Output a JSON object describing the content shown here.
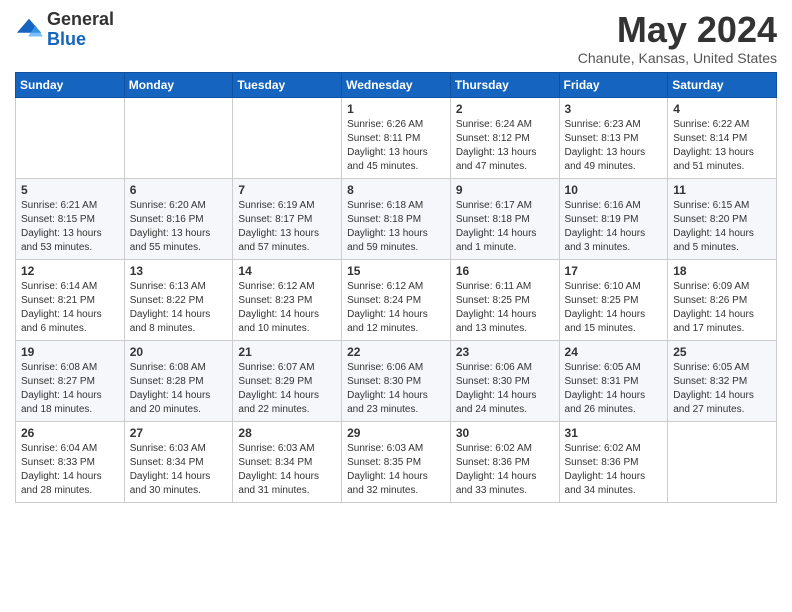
{
  "logo": {
    "general": "General",
    "blue": "Blue"
  },
  "header": {
    "title": "May 2024",
    "subtitle": "Chanute, Kansas, United States"
  },
  "weekdays": [
    "Sunday",
    "Monday",
    "Tuesday",
    "Wednesday",
    "Thursday",
    "Friday",
    "Saturday"
  ],
  "weeks": [
    [
      {
        "day": "",
        "sunrise": "",
        "sunset": "",
        "daylight": ""
      },
      {
        "day": "",
        "sunrise": "",
        "sunset": "",
        "daylight": ""
      },
      {
        "day": "",
        "sunrise": "",
        "sunset": "",
        "daylight": ""
      },
      {
        "day": "1",
        "sunrise": "Sunrise: 6:26 AM",
        "sunset": "Sunset: 8:11 PM",
        "daylight": "Daylight: 13 hours and 45 minutes."
      },
      {
        "day": "2",
        "sunrise": "Sunrise: 6:24 AM",
        "sunset": "Sunset: 8:12 PM",
        "daylight": "Daylight: 13 hours and 47 minutes."
      },
      {
        "day": "3",
        "sunrise": "Sunrise: 6:23 AM",
        "sunset": "Sunset: 8:13 PM",
        "daylight": "Daylight: 13 hours and 49 minutes."
      },
      {
        "day": "4",
        "sunrise": "Sunrise: 6:22 AM",
        "sunset": "Sunset: 8:14 PM",
        "daylight": "Daylight: 13 hours and 51 minutes."
      }
    ],
    [
      {
        "day": "5",
        "sunrise": "Sunrise: 6:21 AM",
        "sunset": "Sunset: 8:15 PM",
        "daylight": "Daylight: 13 hours and 53 minutes."
      },
      {
        "day": "6",
        "sunrise": "Sunrise: 6:20 AM",
        "sunset": "Sunset: 8:16 PM",
        "daylight": "Daylight: 13 hours and 55 minutes."
      },
      {
        "day": "7",
        "sunrise": "Sunrise: 6:19 AM",
        "sunset": "Sunset: 8:17 PM",
        "daylight": "Daylight: 13 hours and 57 minutes."
      },
      {
        "day": "8",
        "sunrise": "Sunrise: 6:18 AM",
        "sunset": "Sunset: 8:18 PM",
        "daylight": "Daylight: 13 hours and 59 minutes."
      },
      {
        "day": "9",
        "sunrise": "Sunrise: 6:17 AM",
        "sunset": "Sunset: 8:18 PM",
        "daylight": "Daylight: 14 hours and 1 minute."
      },
      {
        "day": "10",
        "sunrise": "Sunrise: 6:16 AM",
        "sunset": "Sunset: 8:19 PM",
        "daylight": "Daylight: 14 hours and 3 minutes."
      },
      {
        "day": "11",
        "sunrise": "Sunrise: 6:15 AM",
        "sunset": "Sunset: 8:20 PM",
        "daylight": "Daylight: 14 hours and 5 minutes."
      }
    ],
    [
      {
        "day": "12",
        "sunrise": "Sunrise: 6:14 AM",
        "sunset": "Sunset: 8:21 PM",
        "daylight": "Daylight: 14 hours and 6 minutes."
      },
      {
        "day": "13",
        "sunrise": "Sunrise: 6:13 AM",
        "sunset": "Sunset: 8:22 PM",
        "daylight": "Daylight: 14 hours and 8 minutes."
      },
      {
        "day": "14",
        "sunrise": "Sunrise: 6:12 AM",
        "sunset": "Sunset: 8:23 PM",
        "daylight": "Daylight: 14 hours and 10 minutes."
      },
      {
        "day": "15",
        "sunrise": "Sunrise: 6:12 AM",
        "sunset": "Sunset: 8:24 PM",
        "daylight": "Daylight: 14 hours and 12 minutes."
      },
      {
        "day": "16",
        "sunrise": "Sunrise: 6:11 AM",
        "sunset": "Sunset: 8:25 PM",
        "daylight": "Daylight: 14 hours and 13 minutes."
      },
      {
        "day": "17",
        "sunrise": "Sunrise: 6:10 AM",
        "sunset": "Sunset: 8:25 PM",
        "daylight": "Daylight: 14 hours and 15 minutes."
      },
      {
        "day": "18",
        "sunrise": "Sunrise: 6:09 AM",
        "sunset": "Sunset: 8:26 PM",
        "daylight": "Daylight: 14 hours and 17 minutes."
      }
    ],
    [
      {
        "day": "19",
        "sunrise": "Sunrise: 6:08 AM",
        "sunset": "Sunset: 8:27 PM",
        "daylight": "Daylight: 14 hours and 18 minutes."
      },
      {
        "day": "20",
        "sunrise": "Sunrise: 6:08 AM",
        "sunset": "Sunset: 8:28 PM",
        "daylight": "Daylight: 14 hours and 20 minutes."
      },
      {
        "day": "21",
        "sunrise": "Sunrise: 6:07 AM",
        "sunset": "Sunset: 8:29 PM",
        "daylight": "Daylight: 14 hours and 22 minutes."
      },
      {
        "day": "22",
        "sunrise": "Sunrise: 6:06 AM",
        "sunset": "Sunset: 8:30 PM",
        "daylight": "Daylight: 14 hours and 23 minutes."
      },
      {
        "day": "23",
        "sunrise": "Sunrise: 6:06 AM",
        "sunset": "Sunset: 8:30 PM",
        "daylight": "Daylight: 14 hours and 24 minutes."
      },
      {
        "day": "24",
        "sunrise": "Sunrise: 6:05 AM",
        "sunset": "Sunset: 8:31 PM",
        "daylight": "Daylight: 14 hours and 26 minutes."
      },
      {
        "day": "25",
        "sunrise": "Sunrise: 6:05 AM",
        "sunset": "Sunset: 8:32 PM",
        "daylight": "Daylight: 14 hours and 27 minutes."
      }
    ],
    [
      {
        "day": "26",
        "sunrise": "Sunrise: 6:04 AM",
        "sunset": "Sunset: 8:33 PM",
        "daylight": "Daylight: 14 hours and 28 minutes."
      },
      {
        "day": "27",
        "sunrise": "Sunrise: 6:03 AM",
        "sunset": "Sunset: 8:34 PM",
        "daylight": "Daylight: 14 hours and 30 minutes."
      },
      {
        "day": "28",
        "sunrise": "Sunrise: 6:03 AM",
        "sunset": "Sunset: 8:34 PM",
        "daylight": "Daylight: 14 hours and 31 minutes."
      },
      {
        "day": "29",
        "sunrise": "Sunrise: 6:03 AM",
        "sunset": "Sunset: 8:35 PM",
        "daylight": "Daylight: 14 hours and 32 minutes."
      },
      {
        "day": "30",
        "sunrise": "Sunrise: 6:02 AM",
        "sunset": "Sunset: 8:36 PM",
        "daylight": "Daylight: 14 hours and 33 minutes."
      },
      {
        "day": "31",
        "sunrise": "Sunrise: 6:02 AM",
        "sunset": "Sunset: 8:36 PM",
        "daylight": "Daylight: 14 hours and 34 minutes."
      },
      {
        "day": "",
        "sunrise": "",
        "sunset": "",
        "daylight": ""
      }
    ]
  ]
}
